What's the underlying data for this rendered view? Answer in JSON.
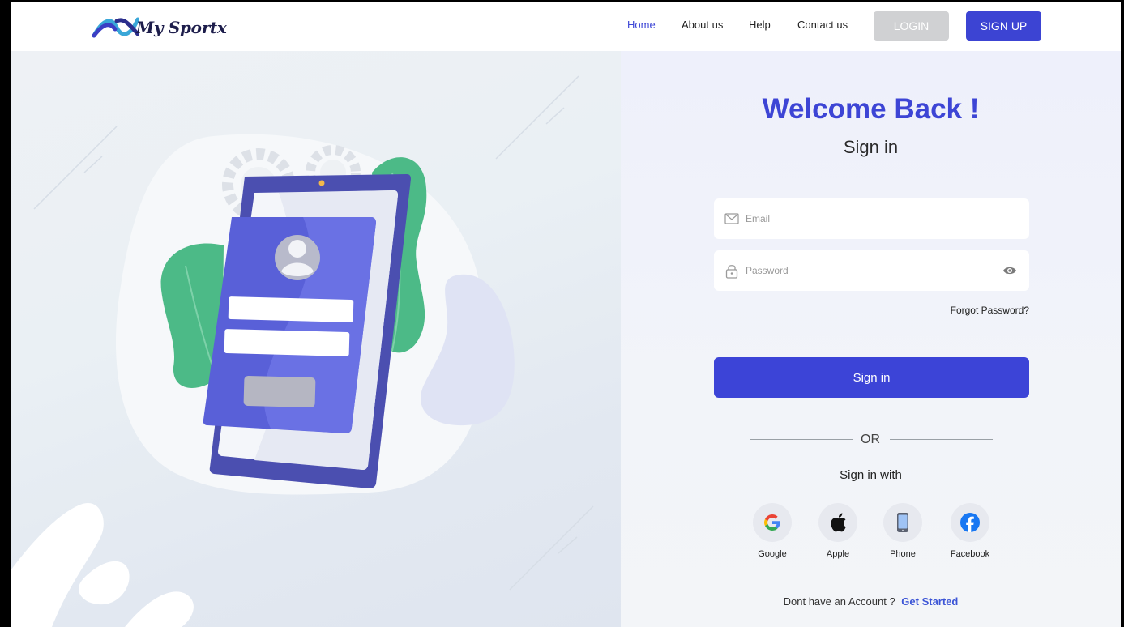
{
  "header": {
    "logo_text": "My Sportx",
    "nav": [
      "Home",
      "About us",
      "Help",
      "Contact us"
    ],
    "login_label": "LOGIN",
    "signup_label": "SIGN UP"
  },
  "form": {
    "welcome": "Welcome Back !",
    "subtitle": "Sign in",
    "email_placeholder": "Email",
    "password_placeholder": "Password",
    "forgot": "Forgot Password?",
    "signin_button": "Sign in",
    "or_text": "OR",
    "signin_with": "Sign in with",
    "social": [
      "Google",
      "Apple",
      "Phone",
      "Facebook"
    ],
    "no_account": "Dont  have an Account ?",
    "get_started": "Get Started"
  },
  "colors": {
    "brand": "#3c44d3",
    "login_disabled": "#d0d1d3",
    "link": "#3c55d6"
  },
  "icons": [
    "email-icon",
    "lock-icon",
    "eye-icon",
    "google-icon",
    "apple-icon",
    "phone-icon",
    "facebook-icon"
  ]
}
